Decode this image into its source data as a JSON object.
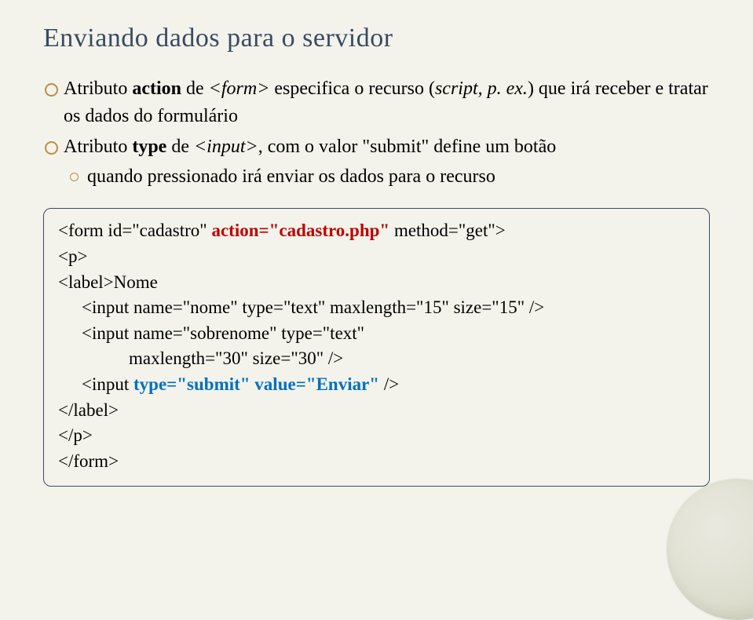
{
  "title": "Enviando dados para o servidor",
  "bullets": {
    "b1_pre": "Atributo ",
    "b1_bold": "action",
    "b1_mid": " de ",
    "b1_ital": "<form>",
    "b1_post": " especifica o recurso (",
    "b1_ital2": "script, p. ex.",
    "b1_end": ") que irá receber e tratar os dados do formulário",
    "b2_pre": "Atributo ",
    "b2_bold": "type",
    "b2_mid": " de ",
    "b2_ital": "<input>",
    "b2_post": ", com o valor \"submit\" define um botão",
    "b2_sub": "quando pressionado irá enviar os dados para o recurso"
  },
  "code": {
    "l1a": "<form id=\"cadastro\" ",
    "l1b_red": "action=\"cadastro.php\"",
    "l1c": " method=\"get\">",
    "l2": "<p>",
    "l3": "<label>Nome",
    "l4": "<input name=\"nome\" type=\"text\" maxlength=\"15\" size=\"15\" />",
    "l5": "<input name=\"sobrenome\" type=\"text\"",
    "l6": "maxlength=\"30\" size=\"30\" />",
    "l7a": "<input ",
    "l7b_blue": "type=\"submit\" value=\"Enviar\"",
    "l7c": " />",
    "l8": "</label>",
    "l9": "</p>",
    "l10": "</form>"
  }
}
